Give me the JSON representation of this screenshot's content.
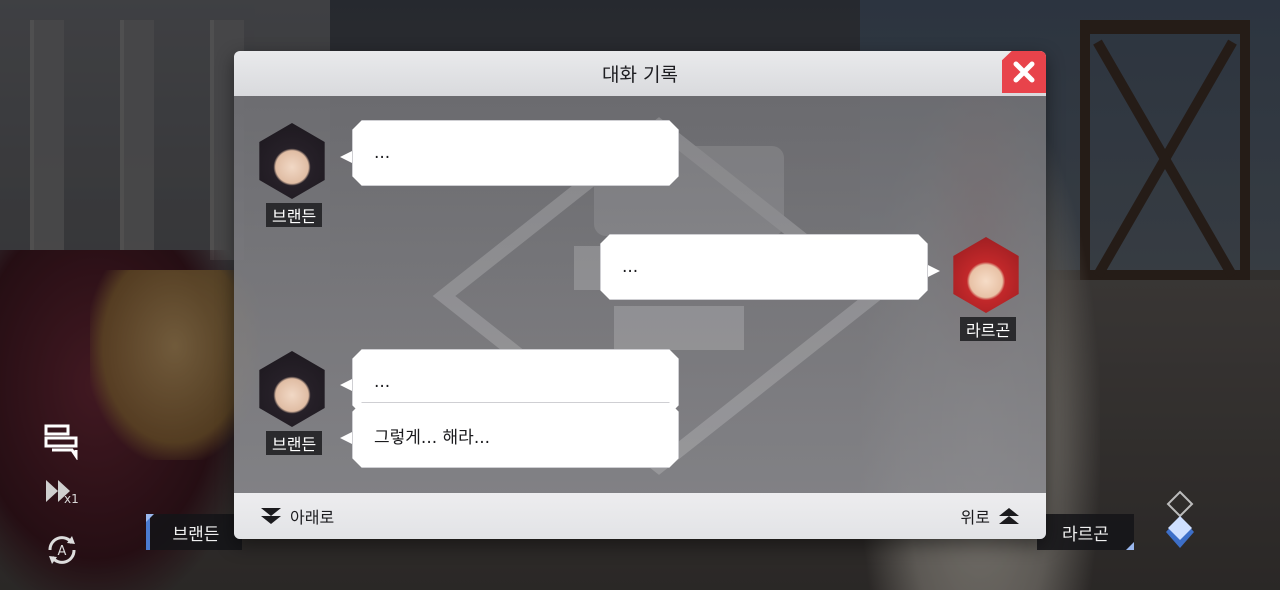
{
  "dialog": {
    "title": "대화 기록",
    "close_icon": "close-icon"
  },
  "messages": [
    {
      "speaker": "브랜든",
      "side": "left",
      "text": "..."
    },
    {
      "speaker": "라르곤",
      "side": "right",
      "text": "..."
    },
    {
      "speaker": "브랜든",
      "side": "left",
      "text": "..."
    },
    {
      "speaker": "",
      "side": "left",
      "text": "그렇게... 해라..."
    }
  ],
  "footer": {
    "down_label": "아래로",
    "up_label": "위로"
  },
  "scene": {
    "left_name": "브랜든",
    "right_name": "라르곤"
  },
  "controls": {
    "speed_multiplier": "x1",
    "log_icon": "chat-log-icon",
    "fast_forward_icon": "fast-forward-icon",
    "auto_icon": "auto-play-icon"
  },
  "colors": {
    "close_red": "#e8434b",
    "accent_blue": "#4b7bd1"
  }
}
